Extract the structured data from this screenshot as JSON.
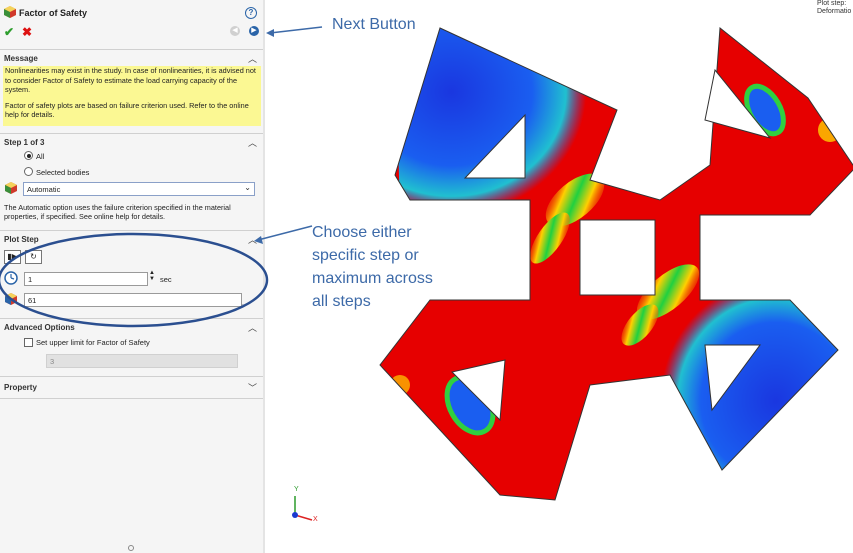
{
  "panel": {
    "title": "Factor of Safety",
    "help_label": "?",
    "message_section": {
      "header": "Message",
      "text1": "Nonlinearities may exist in the study. In case of nonlinearities, it is advised not to consider Factor of Safety to estimate the load carrying capacity of the system.",
      "text2": "Factor of safety plots are based on failure criterion used. Refer to the online help for details."
    },
    "step_section": {
      "header": "Step 1 of 3",
      "radio_all": "All",
      "radio_selected": "Selected bodies",
      "criterion_value": "Automatic",
      "note": "The Automatic option uses the failure criterion specified in the material properties, if specified. See online help for details."
    },
    "plot_step": {
      "header": "Plot Step",
      "time_value": "1",
      "time_unit": "sec",
      "step_value": "61"
    },
    "advanced": {
      "header": "Advanced Options",
      "checkbox_label": "Set upper limit for Factor of Safety",
      "limit_value": "3"
    },
    "property": {
      "header": "Property"
    }
  },
  "annotations": {
    "next_button": "Next Button",
    "choose_line1": "Choose either",
    "choose_line2": "specific step or",
    "choose_line3": "maximum across",
    "choose_line4": "all steps"
  },
  "viewport": {
    "corner_line1": "Plot step:",
    "corner_line2": "Deformatio",
    "triad_x": "X",
    "triad_y": "Y",
    "triad_z": "Z"
  },
  "colors": {
    "accent": "#2a64a8",
    "message_bg": "#fbf893",
    "annotation": "#3d6aa8",
    "fos_high": "#e60000",
    "fos_low": "#1e36e0"
  },
  "icons": [
    "feature-icon",
    "help-icon",
    "checkmark-icon",
    "close-icon",
    "back-arrow-icon",
    "next-arrow-icon",
    "chevron-up-icon",
    "chevron-down-icon",
    "material-icon",
    "play-step-icon",
    "loop-icon",
    "clock-icon",
    "step-icon",
    "triad-icon"
  ]
}
